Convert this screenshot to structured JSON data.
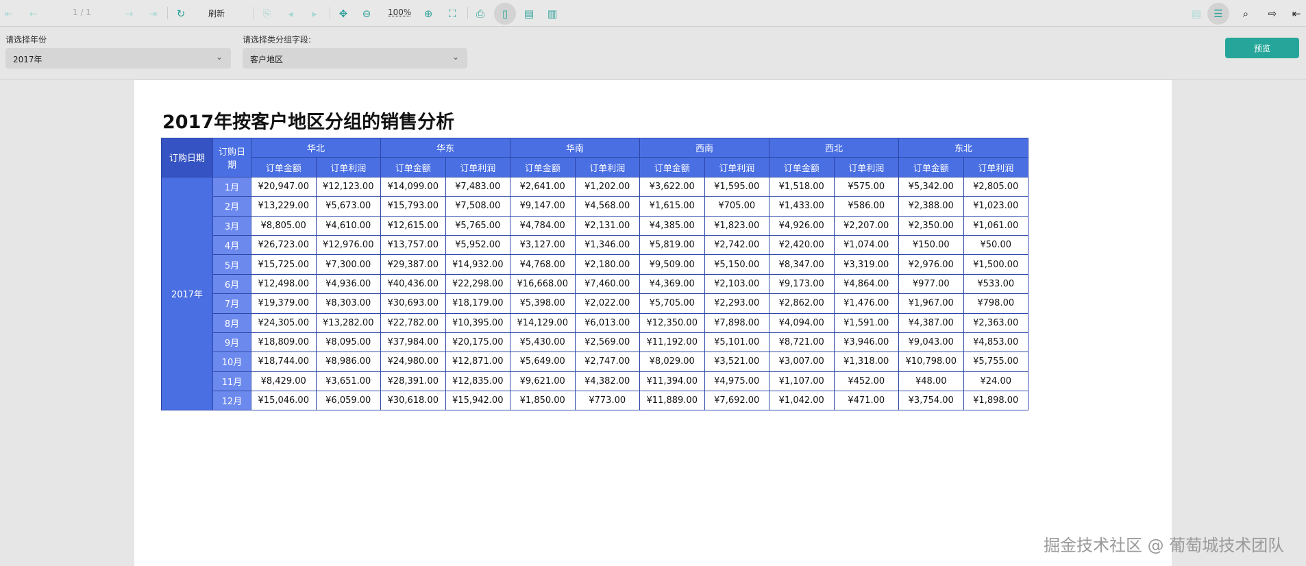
{
  "toolbar": {
    "page_indicator": "1 / 1",
    "refresh_label": "刷新",
    "zoom": "100%"
  },
  "filters": {
    "year_label": "请选择年份",
    "year_value": "2017年",
    "group_label": "请选择类分组字段:",
    "group_value": "客户地区",
    "preview_label": "预览"
  },
  "report": {
    "title": "2017年按客户地区分组的销售分析",
    "col1_header": "订购日期",
    "col2_header": "订购日期",
    "year": "2017年",
    "regions": [
      "华北",
      "华东",
      "华南",
      "西南",
      "西北",
      "东北"
    ],
    "metrics": [
      "订单金额",
      "订单利润"
    ],
    "rows": [
      {
        "month": "1月",
        "values": [
          "¥20,947.00",
          "¥12,123.00",
          "¥14,099.00",
          "¥7,483.00",
          "¥2,641.00",
          "¥1,202.00",
          "¥3,622.00",
          "¥1,595.00",
          "¥1,518.00",
          "¥575.00",
          "¥5,342.00",
          "¥2,805.00"
        ]
      },
      {
        "month": "2月",
        "values": [
          "¥13,229.00",
          "¥5,673.00",
          "¥15,793.00",
          "¥7,508.00",
          "¥9,147.00",
          "¥4,568.00",
          "¥1,615.00",
          "¥705.00",
          "¥1,433.00",
          "¥586.00",
          "¥2,388.00",
          "¥1,023.00"
        ]
      },
      {
        "month": "3月",
        "values": [
          "¥8,805.00",
          "¥4,610.00",
          "¥12,615.00",
          "¥5,765.00",
          "¥4,784.00",
          "¥2,131.00",
          "¥4,385.00",
          "¥1,823.00",
          "¥4,926.00",
          "¥2,207.00",
          "¥2,350.00",
          "¥1,061.00"
        ]
      },
      {
        "month": "4月",
        "values": [
          "¥26,723.00",
          "¥12,976.00",
          "¥13,757.00",
          "¥5,952.00",
          "¥3,127.00",
          "¥1,346.00",
          "¥5,819.00",
          "¥2,742.00",
          "¥2,420.00",
          "¥1,074.00",
          "¥150.00",
          "¥50.00"
        ]
      },
      {
        "month": "5月",
        "values": [
          "¥15,725.00",
          "¥7,300.00",
          "¥29,387.00",
          "¥14,932.00",
          "¥4,768.00",
          "¥2,180.00",
          "¥9,509.00",
          "¥5,150.00",
          "¥8,347.00",
          "¥3,319.00",
          "¥2,976.00",
          "¥1,500.00"
        ]
      },
      {
        "month": "6月",
        "values": [
          "¥12,498.00",
          "¥4,936.00",
          "¥40,436.00",
          "¥22,298.00",
          "¥16,668.00",
          "¥7,460.00",
          "¥4,369.00",
          "¥2,103.00",
          "¥9,173.00",
          "¥4,864.00",
          "¥977.00",
          "¥533.00"
        ]
      },
      {
        "month": "7月",
        "values": [
          "¥19,379.00",
          "¥8,303.00",
          "¥30,693.00",
          "¥18,179.00",
          "¥5,398.00",
          "¥2,022.00",
          "¥5,705.00",
          "¥2,293.00",
          "¥2,862.00",
          "¥1,476.00",
          "¥1,967.00",
          "¥798.00"
        ]
      },
      {
        "month": "8月",
        "values": [
          "¥24,305.00",
          "¥13,282.00",
          "¥22,782.00",
          "¥10,395.00",
          "¥14,129.00",
          "¥6,013.00",
          "¥12,350.00",
          "¥7,898.00",
          "¥4,094.00",
          "¥1,591.00",
          "¥4,387.00",
          "¥2,363.00"
        ]
      },
      {
        "month": "9月",
        "values": [
          "¥18,809.00",
          "¥8,095.00",
          "¥37,984.00",
          "¥20,175.00",
          "¥5,430.00",
          "¥2,569.00",
          "¥11,192.00",
          "¥5,101.00",
          "¥8,721.00",
          "¥3,946.00",
          "¥9,043.00",
          "¥4,853.00"
        ]
      },
      {
        "month": "10月",
        "values": [
          "¥18,744.00",
          "¥8,986.00",
          "¥24,980.00",
          "¥12,871.00",
          "¥5,649.00",
          "¥2,747.00",
          "¥8,029.00",
          "¥3,521.00",
          "¥3,007.00",
          "¥1,318.00",
          "¥10,798.00",
          "¥5,755.00"
        ]
      },
      {
        "month": "11月",
        "values": [
          "¥8,429.00",
          "¥3,651.00",
          "¥28,391.00",
          "¥12,835.00",
          "¥9,621.00",
          "¥4,382.00",
          "¥11,394.00",
          "¥4,975.00",
          "¥1,107.00",
          "¥452.00",
          "¥48.00",
          "¥24.00"
        ]
      },
      {
        "month": "12月",
        "values": [
          "¥15,046.00",
          "¥6,059.00",
          "¥30,618.00",
          "¥15,942.00",
          "¥1,850.00",
          "¥773.00",
          "¥11,889.00",
          "¥7,692.00",
          "¥1,042.00",
          "¥471.00",
          "¥3,754.00",
          "¥1,898.00"
        ]
      }
    ]
  },
  "watermark": "掘金技术社区 @ 葡萄城技术团队",
  "colors": {
    "accent": "#26a69a",
    "header": "#4a6fe3",
    "month": "#6c89ee"
  }
}
